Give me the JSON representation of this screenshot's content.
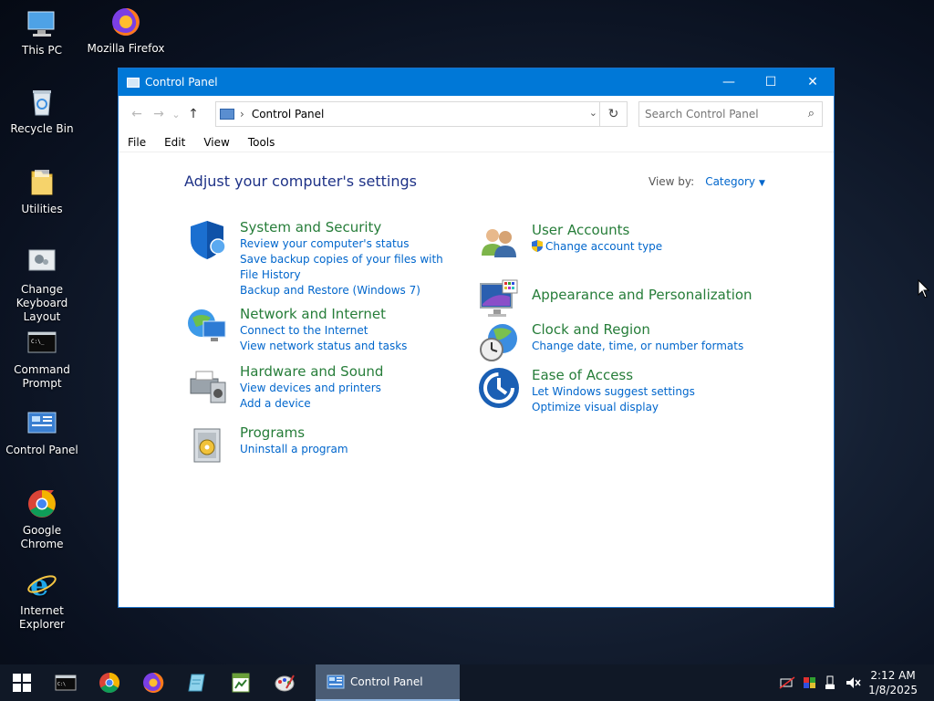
{
  "desktop": {
    "icons": [
      {
        "label": "This PC"
      },
      {
        "label": "Mozilla Firefox"
      },
      {
        "label": "Recycle Bin"
      },
      {
        "label": "Utilities"
      },
      {
        "label": "Change Keyboard Layout"
      },
      {
        "label": "Command Prompt"
      },
      {
        "label": "Control Panel"
      },
      {
        "label": "Google Chrome"
      },
      {
        "label": "Internet Explorer"
      }
    ]
  },
  "window": {
    "title": "Control Panel",
    "controls": {
      "minimize": "—",
      "maximize": "☐",
      "close": "✕"
    },
    "nav": {
      "back": "←",
      "forward": "→",
      "recent": "⌄",
      "up": "↑"
    },
    "address": {
      "crumb_sep": "›",
      "path": "Control Panel",
      "dropdown": "⌄",
      "refresh": "↻"
    },
    "search": {
      "placeholder": "Search Control Panel",
      "icon": "⌕"
    },
    "menu": [
      "File",
      "Edit",
      "View",
      "Tools"
    ],
    "heading": "Adjust your computer's settings",
    "view_by": {
      "label": "View by:",
      "value": "Category",
      "caret": "▼"
    },
    "categories_left": [
      {
        "title": "System and Security",
        "links": [
          "Review your computer's status",
          "Save backup copies of your files with File History",
          "Backup and Restore (Windows 7)"
        ]
      },
      {
        "title": "Network and Internet",
        "links": [
          "Connect to the Internet",
          "View network status and tasks"
        ]
      },
      {
        "title": "Hardware and Sound",
        "links": [
          "View devices and printers",
          "Add a device"
        ]
      },
      {
        "title": "Programs",
        "links": [
          "Uninstall a program"
        ]
      }
    ],
    "categories_right": [
      {
        "title": "User Accounts",
        "links": [
          "Change account type"
        ]
      },
      {
        "title": "Appearance and Personalization",
        "links": []
      },
      {
        "title": "Clock and Region",
        "links": [
          "Change date, time, or number formats"
        ]
      },
      {
        "title": "Ease of Access",
        "links": [
          "Let Windows suggest settings",
          "Optimize visual display"
        ]
      }
    ]
  },
  "taskbar": {
    "active_label": "Control Panel",
    "clock_time": "2:12 AM",
    "clock_date": "1/8/2025"
  },
  "colors": {
    "titlebar": "#0078d7",
    "category_title": "#267d39",
    "link": "#0066cc",
    "heading": "#1e3287"
  }
}
